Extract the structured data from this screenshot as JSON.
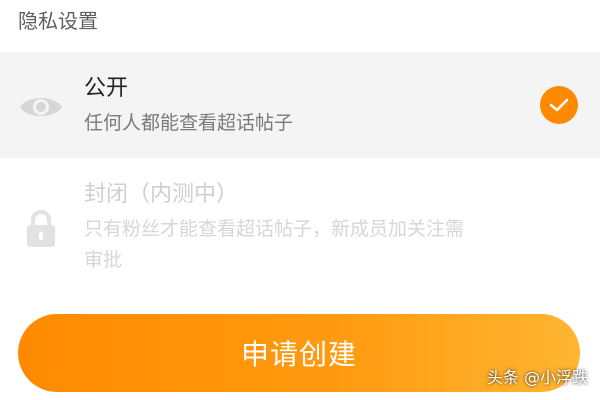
{
  "section": {
    "title": "隐私设置"
  },
  "options": [
    {
      "title": "公开",
      "description": "任何人都能查看超话帖子",
      "icon": "eye-icon",
      "selected": true
    },
    {
      "title": "封闭（内测中）",
      "description": "只有粉丝才能查看超话帖子，新成员加关注需审批",
      "icon": "lock-icon",
      "selected": false
    }
  ],
  "button": {
    "label": "申请创建"
  },
  "watermark": {
    "text": "头条 @小浮跌"
  },
  "colors": {
    "accent": "#ff8a00",
    "accent_end": "#ffb531",
    "selected_bg": "#f4f4f4",
    "disabled_text": "#d6d6d6"
  }
}
